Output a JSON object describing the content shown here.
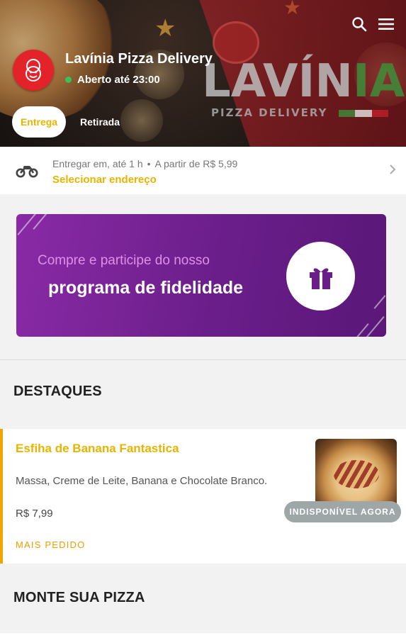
{
  "header": {
    "brand_logo_text": "LAVÍNIA",
    "brand_logo_sub": "PIZZA DELIVERY",
    "store_name": "Lavínia Pizza Delivery",
    "status_text": "Aberto até 23:00",
    "status_color": "#39c15a",
    "icons": [
      "search-icon",
      "menu-icon"
    ],
    "tabs": [
      {
        "label": "Entrega",
        "active": true
      },
      {
        "label": "Retirada",
        "active": false
      }
    ]
  },
  "delivery": {
    "eta_text": "Entregar em, até 1 h",
    "price_text": "A partir de R$ 5,99",
    "select_address": "Selecionar endereço"
  },
  "loyalty": {
    "line1": "Compre e participe do nosso",
    "line2": "programa de fidelidade",
    "icon": "gift-icon"
  },
  "sections": {
    "highlights_title": "DESTAQUES",
    "build_pizza_title": "MONTE SUA PIZZA"
  },
  "product": {
    "name": "Esfiha de Banana Fantastica",
    "description": "Massa, Creme de Leite, Banana e Chocolate Branco.",
    "price": "R$ 7,99",
    "tag": "MAIS PEDIDO",
    "unavailable_badge": "INDISPONÍVEL AGORA"
  },
  "colors": {
    "accent": "#e8b400",
    "brand_red": "#e4222a",
    "loyalty_purple": "#7a23a0",
    "badge_gray": "#9ea6a8"
  }
}
